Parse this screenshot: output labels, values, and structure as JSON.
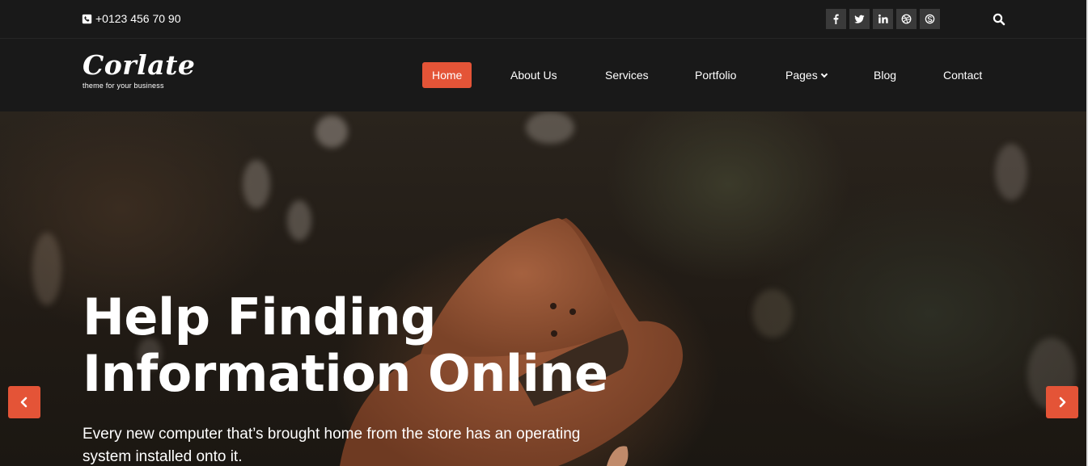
{
  "topbar": {
    "phone": "+0123 456 70 90",
    "phone_icon": "phone-icon",
    "socials": [
      {
        "name": "facebook-icon",
        "glyph": "f"
      },
      {
        "name": "twitter-icon",
        "glyph": "t"
      },
      {
        "name": "linkedin-icon",
        "glyph": "in"
      },
      {
        "name": "dribbble-icon",
        "glyph": "d"
      },
      {
        "name": "skype-icon",
        "glyph": "S"
      }
    ],
    "search_icon": "search-icon"
  },
  "logo": {
    "name": "Corlate",
    "tagline": "theme for your business"
  },
  "menu": {
    "home": "Home",
    "about": "About Us",
    "services": "Services",
    "portfolio": "Portfolio",
    "pages": "Pages",
    "blog": "Blog",
    "contact": "Contact"
  },
  "hero": {
    "headline_line1": "Help Finding",
    "headline_line2": "Information Online",
    "subtext": "Every new computer that’s brought home from the store has an operating system installed onto it."
  },
  "colors": {
    "accent": "#e45437",
    "bar_bg": "#191919",
    "social_bg": "#3a3a3a"
  }
}
